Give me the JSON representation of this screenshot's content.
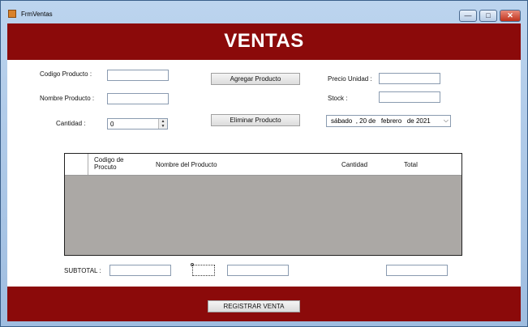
{
  "window": {
    "title": "FrmVentas",
    "min_glyph": "—",
    "max_glyph": "□",
    "close_glyph": "✕"
  },
  "header": {
    "title": "VENTAS"
  },
  "form": {
    "codigo_label": "Codigo Producto :",
    "nombre_label": "Nombre Producto :",
    "cantidad_label": "Cantidad :",
    "cantidad_value": "0",
    "precio_label": "Precio Unidad :",
    "stock_label": "Stock :",
    "agregar_label": "Agregar Producto",
    "eliminar_label": "Eliminar Producto",
    "fecha_value": "sábado  , 20 de   febrero   de 2021"
  },
  "grid": {
    "columns": [
      {
        "label_line1": "Codigo de",
        "label_line2": "Procuto"
      },
      {
        "label_line1": "Nombre del Producto",
        "label_line2": ""
      },
      {
        "label_line1": "Cantidad",
        "label_line2": ""
      },
      {
        "label_line1": "Total",
        "label_line2": ""
      }
    ]
  },
  "totals": {
    "subtotal_label": "SUBTOTAL :"
  },
  "footer": {
    "registrar_label": "REGISTRAR VENTA"
  },
  "colors": {
    "brand_red": "#8b0a0a",
    "grid_bg": "#aba8a5"
  }
}
